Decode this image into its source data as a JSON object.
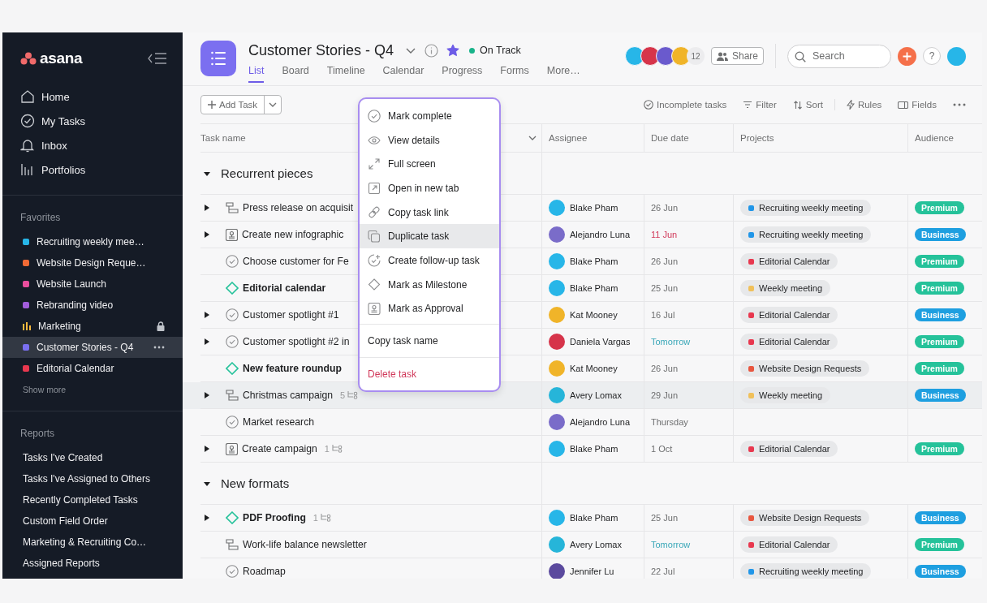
{
  "sidebar": {
    "logo": "asana",
    "nav": [
      {
        "kind": "home",
        "label": "Home"
      },
      {
        "kind": "tasks",
        "label": "My Tasks"
      },
      {
        "kind": "inbox",
        "label": "Inbox"
      },
      {
        "kind": "portfolios",
        "label": "Portfolios"
      }
    ],
    "favorites_title": "Favorites",
    "favorites": [
      {
        "label": "Recruiting weekly mee…",
        "kind": "dot",
        "color": "#27b6e8",
        "locked": false,
        "selected": false
      },
      {
        "label": "Website Design Reque…",
        "kind": "dot",
        "color": "#f06a35",
        "locked": false,
        "selected": false
      },
      {
        "label": "Website Launch",
        "kind": "dot",
        "color": "#ea4e9d",
        "locked": false,
        "selected": false
      },
      {
        "label": "Rebranding video",
        "kind": "dot",
        "color": "#a25ddc",
        "locked": false,
        "selected": false
      },
      {
        "label": "Marketing",
        "kind": "portfolio",
        "color": "#f8b93d",
        "locked": true,
        "selected": false
      },
      {
        "label": "Customer Stories - Q4",
        "kind": "dot",
        "color": "#7a6ff0",
        "locked": false,
        "selected": true
      },
      {
        "label": "Editorial Calendar",
        "kind": "dot",
        "color": "#e8384f",
        "locked": false,
        "selected": false
      }
    ],
    "show_more": "Show more",
    "reports_title": "Reports",
    "reports": [
      "Tasks I've Created",
      "Tasks I've Assigned to Others",
      "Recently Completed Tasks",
      "Custom Field Order",
      "Marketing & Recruiting Co…",
      "Assigned Reports"
    ]
  },
  "project": {
    "title": "Customer Stories - Q4",
    "starred": true,
    "status": {
      "label": "On Track",
      "color": "#19b38a"
    },
    "tabs": [
      {
        "label": "List",
        "selected": true
      },
      {
        "label": "Board",
        "selected": false
      },
      {
        "label": "Timeline",
        "selected": false
      },
      {
        "label": "Calendar",
        "selected": false
      },
      {
        "label": "Progress",
        "selected": false
      },
      {
        "label": "Forms",
        "selected": false
      },
      {
        "label": "More…",
        "selected": false
      }
    ],
    "members": [
      {
        "color": "#27b6e8"
      },
      {
        "color": "#d6344a"
      },
      {
        "color": "#6a5acd"
      },
      {
        "color": "#f0b429"
      }
    ],
    "member_count": "12",
    "share": "Share",
    "search": {
      "placeholder": "Search"
    },
    "help": "?"
  },
  "toolbar": {
    "add_task": "Add Task",
    "incomplete": "Incomplete tasks",
    "filter": "Filter",
    "sort": "Sort",
    "rules": "Rules",
    "fields": "Fields"
  },
  "table": {
    "columns": [
      "Task name",
      "Assignee",
      "Due date",
      "Projects",
      "Audience"
    ],
    "sections": [
      {
        "title": "Recurrent pieces",
        "expanded": true,
        "rows": [
          {
            "name": "Press release on acquisit",
            "kind": "form",
            "expandable": true,
            "subtasks": "",
            "highlighted": false,
            "assignee": {
              "name": "Blake Pham",
              "color": "#27b6e8"
            },
            "due": "26 Jun",
            "overdue": false,
            "soon": false,
            "project": {
              "name": "Recruiting weekly meeting",
              "color": "#2196e8"
            },
            "audience": {
              "label": "Premium",
              "color": "#25c29a"
            }
          },
          {
            "name": "Create new infographic",
            "kind": "approval",
            "expandable": true,
            "subtasks": "",
            "highlighted": false,
            "assignee": {
              "name": "Alejandro Luna",
              "color": "#7a6cc9"
            },
            "due": "11 Jun",
            "overdue": true,
            "soon": false,
            "project": {
              "name": "Recruiting weekly meeting",
              "color": "#2196e8"
            },
            "audience": {
              "label": "Business",
              "color": "#1e9fe0"
            }
          },
          {
            "name": "Choose customer for Fe",
            "kind": "task",
            "expandable": false,
            "subtasks": "",
            "highlighted": false,
            "assignee": {
              "name": "Blake Pham",
              "color": "#27b6e8"
            },
            "due": "26 Jun",
            "overdue": false,
            "soon": false,
            "project": {
              "name": "Editorial Calendar",
              "color": "#e8384f"
            },
            "audience": {
              "label": "Premium",
              "color": "#25c29a"
            }
          },
          {
            "name": "Editorial calendar",
            "kind": "milestone",
            "expandable": false,
            "subtasks": "",
            "highlighted": false,
            "assignee": {
              "name": "Blake Pham",
              "color": "#27b6e8"
            },
            "due": "25 Jun",
            "overdue": false,
            "soon": false,
            "project": {
              "name": "Weekly meeting",
              "color": "#f0c05a"
            },
            "audience": {
              "label": "Premium",
              "color": "#25c29a"
            }
          },
          {
            "name": "Customer spotlight #1",
            "kind": "task",
            "expandable": true,
            "subtasks": "",
            "highlighted": false,
            "assignee": {
              "name": "Kat Mooney",
              "color": "#f0b429"
            },
            "due": "16 Jul",
            "overdue": false,
            "soon": false,
            "project": {
              "name": "Editorial Calendar",
              "color": "#e8384f"
            },
            "audience": {
              "label": "Business",
              "color": "#1e9fe0"
            }
          },
          {
            "name": "Customer spotlight #2 in",
            "kind": "task",
            "expandable": true,
            "subtasks": "",
            "highlighted": false,
            "assignee": {
              "name": "Daniela Vargas",
              "color": "#d6344a"
            },
            "due": "Tomorrow",
            "overdue": false,
            "soon": true,
            "project": {
              "name": "Editorial Calendar",
              "color": "#e8384f"
            },
            "audience": {
              "label": "Premium",
              "color": "#25c29a"
            }
          },
          {
            "name": "New feature roundup",
            "kind": "milestone",
            "expandable": false,
            "subtasks": "",
            "highlighted": false,
            "assignee": {
              "name": "Kat Mooney",
              "color": "#f0b429"
            },
            "due": "26 Jun",
            "overdue": false,
            "soon": false,
            "project": {
              "name": "Website Design Requests",
              "color": "#e8563f"
            },
            "audience": {
              "label": "Premium",
              "color": "#25c29a"
            }
          },
          {
            "name": "Christmas campaign",
            "kind": "form",
            "expandable": true,
            "subtasks": "5",
            "highlighted": true,
            "assignee": {
              "name": "Avery Lomax",
              "color": "#26b5d9"
            },
            "due": "29 Jun",
            "overdue": false,
            "soon": false,
            "project": {
              "name": "Weekly meeting",
              "color": "#f0c05a"
            },
            "audience": {
              "label": "Business",
              "color": "#1e9fe0"
            }
          },
          {
            "name": "Market research",
            "kind": "task",
            "expandable": false,
            "subtasks": "",
            "highlighted": false,
            "assignee": {
              "name": "Alejandro Luna",
              "color": "#7a6cc9"
            },
            "due": "Thursday",
            "overdue": false,
            "soon": false
          },
          {
            "name": "Create campaign",
            "kind": "approval",
            "expandable": true,
            "subtasks": "1",
            "highlighted": false,
            "assignee": {
              "name": "Blake Pham",
              "color": "#27b6e8"
            },
            "due": "1 Oct",
            "overdue": false,
            "soon": false,
            "project": {
              "name": "Editorial Calendar",
              "color": "#e8384f"
            },
            "audience": {
              "label": "Premium",
              "color": "#25c29a"
            }
          }
        ]
      },
      {
        "title": "New formats",
        "expanded": true,
        "rows": [
          {
            "name": "PDF Proofing",
            "kind": "milestone",
            "expandable": true,
            "subtasks": "1",
            "highlighted": false,
            "assignee": {
              "name": "Blake Pham",
              "color": "#27b6e8"
            },
            "due": "25 Jun",
            "overdue": false,
            "soon": false,
            "project": {
              "name": "Website Design Requests",
              "color": "#e8563f"
            },
            "audience": {
              "label": "Business",
              "color": "#1e9fe0"
            }
          },
          {
            "name": "Work-life balance newsletter",
            "kind": "form",
            "expandable": false,
            "subtasks": "",
            "highlighted": false,
            "assignee": {
              "name": "Avery Lomax",
              "color": "#26b5d9"
            },
            "due": "Tomorrow",
            "overdue": false,
            "soon": true,
            "project": {
              "name": "Editorial Calendar",
              "color": "#e8384f"
            },
            "audience": {
              "label": "Premium",
              "color": "#25c29a"
            }
          },
          {
            "name": "Roadmap",
            "kind": "task",
            "expandable": false,
            "subtasks": "",
            "highlighted": false,
            "assignee": {
              "name": "Jennifer Lu",
              "color": "#5b4a9e"
            },
            "due": "22 Jul",
            "overdue": false,
            "soon": false,
            "project": {
              "name": "Recruiting weekly meeting",
              "color": "#2196e8"
            },
            "audience": {
              "label": "Business",
              "color": "#1e9fe0"
            }
          }
        ]
      }
    ]
  },
  "context_menu": {
    "groups": [
      [
        {
          "label": "Mark complete",
          "kind": "complete",
          "selected": false
        },
        {
          "label": "View details",
          "kind": "details",
          "selected": false
        },
        {
          "label": "Full screen",
          "kind": "fullscreen",
          "selected": false
        },
        {
          "label": "Open in new tab",
          "kind": "newtab",
          "selected": false
        },
        {
          "label": "Copy task link",
          "kind": "link",
          "selected": false
        },
        {
          "label": "Duplicate task",
          "kind": "duplicate",
          "selected": true
        },
        {
          "label": "Create follow-up task",
          "kind": "followup",
          "selected": false
        },
        {
          "label": "Mark as Milestone",
          "kind": "milestone",
          "selected": false
        },
        {
          "label": "Mark as Approval",
          "kind": "approval",
          "selected": false
        }
      ],
      [
        {
          "label": "Copy task name",
          "kind": "plain",
          "selected": false
        }
      ],
      [
        {
          "label": "Delete task",
          "kind": "danger",
          "selected": false
        }
      ]
    ]
  }
}
